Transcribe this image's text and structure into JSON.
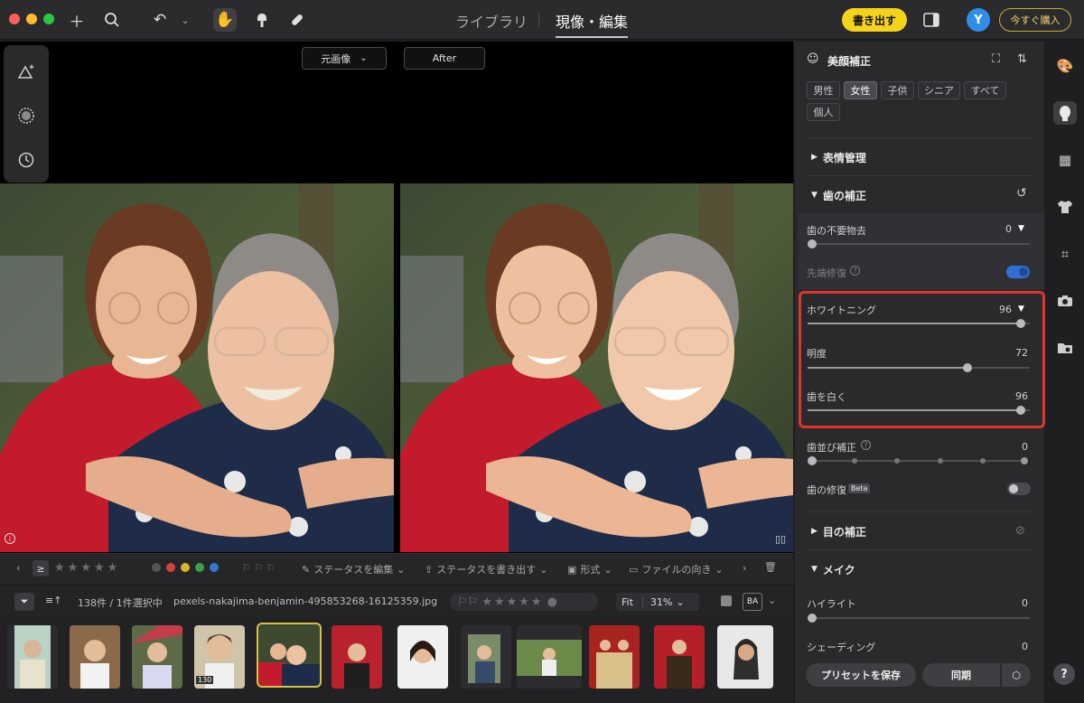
{
  "topbar": {
    "tabs": [
      "ライブラリ",
      "現像・編集"
    ],
    "export_label": "書き出す",
    "avatar_initial": "Y",
    "buy_label": "今すぐ購入"
  },
  "viewer": {
    "compare_select": "元画像",
    "after_label": "After"
  },
  "toolbar": {
    "edit_status": "ステータスを編集",
    "export_status": "ステータスを書き出す",
    "format": "形式",
    "orientation": "ファイルの向き",
    "ge": "≥"
  },
  "infobar": {
    "count": "138件 / 1件選択中",
    "filename": "pexels-nakajima-benjamin-495853268-16125359.jpg",
    "fit": "Fit",
    "zoom": "31%",
    "ba": "BA"
  },
  "filmstrip": {
    "badge": "130"
  },
  "panel": {
    "title": "美顔補正",
    "filters": [
      "男性",
      "女性",
      "子供",
      "シニア",
      "すべて",
      "個人"
    ],
    "selected_filter": "女性",
    "sections": {
      "expression": "表情管理",
      "teeth": "歯の補正",
      "eyes": "目の補正",
      "makeup": "メイク"
    },
    "sliders": {
      "stain_removal": {
        "label": "歯の不要物去",
        "value": "0",
        "level": 0
      },
      "tip_repair": {
        "label": "先端修復"
      },
      "whitening": {
        "label": "ホワイトニング",
        "value": "96",
        "level": 0.96
      },
      "brightness": {
        "label": "明度",
        "value": "72",
        "level": 0.72
      },
      "white": {
        "label": "歯を白く",
        "value": "96",
        "level": 0.96
      },
      "alignment": {
        "label": "歯並び補正",
        "value": "0",
        "level": 0
      },
      "repair": {
        "label": "歯の修復",
        "beta": "Beta"
      },
      "highlight": {
        "label": "ハイライト",
        "value": "0",
        "level": 0
      },
      "shading": {
        "label": "シェーディング",
        "value": "0"
      }
    },
    "save_preset": "プリセットを保存",
    "sync": "同期"
  },
  "colors": {
    "accent_yellow": "#f5d31a",
    "highlight_red": "#e0342d",
    "toggle_on": "#2f6fd6"
  }
}
